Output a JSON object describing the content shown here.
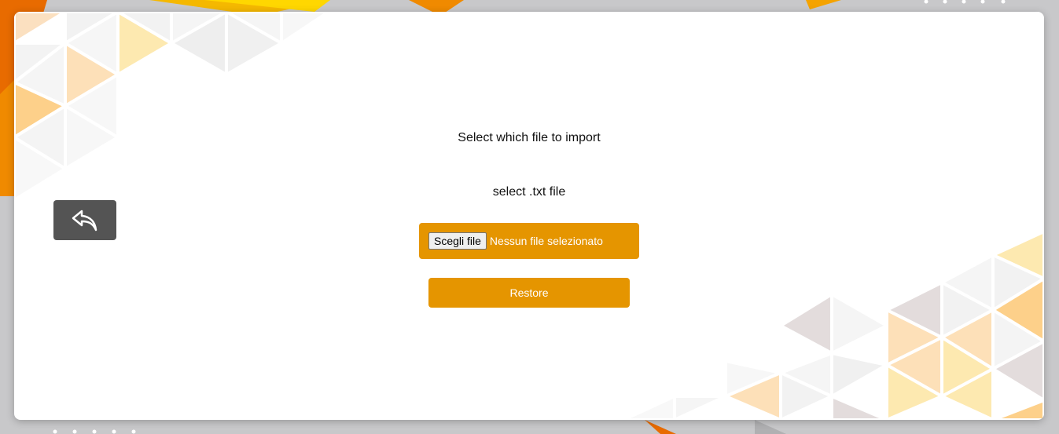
{
  "page": {
    "title": "Select which file to import",
    "subtitle": "select .txt file"
  },
  "file_input": {
    "button_label": "Scegli file",
    "status": "Nessun file selezionato"
  },
  "actions": {
    "restore_label": "Restore"
  },
  "icons": {
    "back": "undo-arrow-icon"
  },
  "colors": {
    "accent": "#e59500",
    "back_button": "#545454",
    "background": "#c9c9ca",
    "card": "#ffffff"
  }
}
